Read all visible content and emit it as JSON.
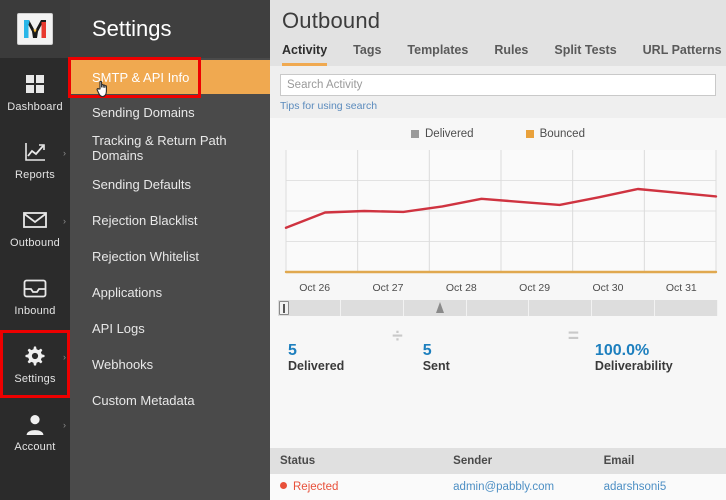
{
  "brand": {
    "logo_letter": "M",
    "logo_name": "mailgun-logo"
  },
  "rail": {
    "items": [
      {
        "label": "Dashboard",
        "icon": "grid-icon",
        "caret": false,
        "highlighted": false
      },
      {
        "label": "Reports",
        "icon": "chart-line-icon",
        "caret": true,
        "highlighted": false
      },
      {
        "label": "Outbound",
        "icon": "envelope-icon",
        "caret": true,
        "highlighted": false
      },
      {
        "label": "Inbound",
        "icon": "inbox-icon",
        "caret": false,
        "highlighted": false
      },
      {
        "label": "Settings",
        "icon": "gear-icon",
        "caret": true,
        "highlighted": true
      },
      {
        "label": "Account",
        "icon": "user-icon",
        "caret": true,
        "highlighted": false
      }
    ],
    "caret_glyph": "›"
  },
  "submenu": {
    "title": "Settings",
    "active_item": "SMTP & API Info",
    "items": [
      "SMTP & API Info",
      "Sending Domains",
      "Tracking & Return Path Domains",
      "Sending Defaults",
      "Rejection Blacklist",
      "Rejection Whitelist",
      "Applications",
      "API Logs",
      "Webhooks",
      "Custom Metadata"
    ]
  },
  "highlight": {
    "color": "#ee0000",
    "band_color": "#f0a950"
  },
  "header": {
    "title": "Outbound",
    "tabs": [
      {
        "label": "Activity",
        "active": true
      },
      {
        "label": "Tags",
        "active": false
      },
      {
        "label": "Templates",
        "active": false
      },
      {
        "label": "Rules",
        "active": false
      },
      {
        "label": "Split Tests",
        "active": false
      },
      {
        "label": "URL Patterns",
        "active": false
      }
    ]
  },
  "search": {
    "value": "",
    "placeholder": "Search Activity",
    "tips_label": "Tips for using search"
  },
  "chart_data": {
    "type": "line",
    "title": "",
    "xlabel": "",
    "ylabel": "",
    "grid": true,
    "legend_position": "top-center",
    "categories": [
      "Oct 26",
      "Oct 27",
      "Oct 28",
      "Oct 29",
      "Oct 30",
      "Oct 31"
    ],
    "xtick_labels": [
      "Oct 26",
      "Oct 27",
      "Oct 28",
      "Oct 29",
      "Oct 30",
      "Oct 31"
    ],
    "ylim": [
      0,
      4
    ],
    "x": [
      0,
      0.5,
      1,
      1.5,
      2,
      2.5,
      3,
      3.5,
      4,
      4.5,
      5,
      5.5
    ],
    "series": [
      {
        "name": "Delivered",
        "color": "#cf3340",
        "legend_color": "#9a9a9a",
        "values": [
          1.45,
          1.95,
          2.0,
          1.97,
          2.15,
          2.4,
          2.3,
          2.2,
          2.45,
          2.72,
          2.6,
          2.48
        ]
      },
      {
        "name": "Bounced",
        "color": "#e0a84f",
        "legend_color": "#e9a13b",
        "values": [
          0,
          0,
          0,
          0,
          0,
          0,
          0,
          0,
          0,
          0,
          0,
          0
        ]
      }
    ]
  },
  "range_slider": {
    "segments": 7,
    "marker_position_pct": 36,
    "handle_position_pct": 0
  },
  "stats": [
    {
      "value": "5",
      "label": "Delivered"
    },
    {
      "value": "5",
      "label": "Sent"
    },
    {
      "value": "100.0%",
      "label": "Deliverability"
    }
  ],
  "stat_ops": {
    "divide": "÷",
    "equals": "="
  },
  "table": {
    "columns": [
      "Status",
      "Sender",
      "Email"
    ],
    "rows": [
      {
        "status": "Rejected",
        "status_color": "#e8503a",
        "sender": "admin@pabbly.com",
        "email": "adarshsoni5"
      }
    ]
  }
}
